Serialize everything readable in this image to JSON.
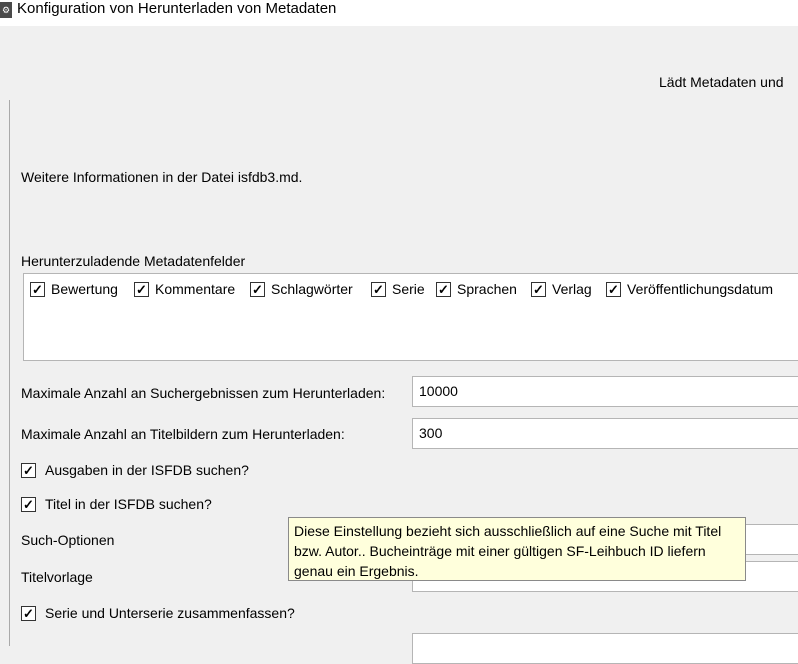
{
  "window": {
    "title": "Konfiguration von Herunterladen von Metadaten",
    "icon": "gear-app-icon"
  },
  "header": {
    "text": "Lädt Metadaten und"
  },
  "info": {
    "text": "Weitere Informationen in der Datei isfdb3.md."
  },
  "fields": {
    "label": "Herunterzuladende Metadatenfelder",
    "items": [
      {
        "label": "Bewertung",
        "checked": true
      },
      {
        "label": "Kommentare",
        "checked": true
      },
      {
        "label": "Schlagwörter",
        "checked": true
      },
      {
        "label": "Serie",
        "checked": true
      },
      {
        "label": "Sprachen",
        "checked": true
      },
      {
        "label": "Verlag",
        "checked": true
      },
      {
        "label": "Veröffentlichungsdatum",
        "checked": true
      }
    ]
  },
  "max_results": {
    "label": "Maximale Anzahl an Suchergebnissen zum Herunterladen:",
    "value": "10000"
  },
  "max_covers": {
    "label": "Maximale Anzahl an Titelbildern zum Herunterladen:",
    "value": "300"
  },
  "search_editions": {
    "label": "Ausgaben in der ISFDB suchen?",
    "checked": true
  },
  "search_titles": {
    "label": "Titel in der ISFDB suchen?",
    "checked": true
  },
  "search_options": {
    "label": "Such-Optionen"
  },
  "title_template": {
    "label": "Titelvorlage"
  },
  "combine_series": {
    "label": "Serie und Unterserie zusammenfassen?",
    "checked": true
  },
  "tooltip": {
    "lines": [
      "Diese Einstellung bezieht sich ausschließlich auf eine Suche mit Titel",
      "bzw. Autor.. Bucheinträge mit einer gültigen  SF-Leihbuch ID liefern",
      "genau ein Ergebnis."
    ]
  }
}
